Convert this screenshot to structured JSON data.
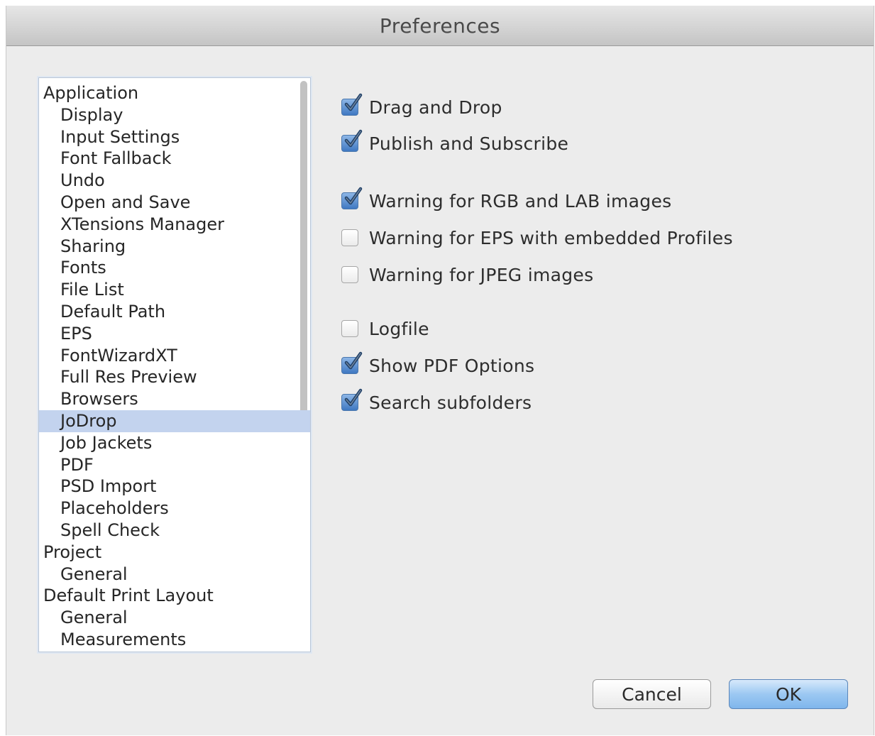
{
  "window": {
    "title": "Preferences"
  },
  "sidebar": {
    "selected": "JoDrop",
    "items": [
      {
        "label": "Application",
        "level": 0
      },
      {
        "label": "Display",
        "level": 1
      },
      {
        "label": "Input Settings",
        "level": 1
      },
      {
        "label": "Font Fallback",
        "level": 1
      },
      {
        "label": "Undo",
        "level": 1
      },
      {
        "label": "Open and Save",
        "level": 1
      },
      {
        "label": "XTensions Manager",
        "level": 1
      },
      {
        "label": "Sharing",
        "level": 1
      },
      {
        "label": "Fonts",
        "level": 1
      },
      {
        "label": "File List",
        "level": 1
      },
      {
        "label": "Default Path",
        "level": 1
      },
      {
        "label": "EPS",
        "level": 1
      },
      {
        "label": "FontWizardXT",
        "level": 1
      },
      {
        "label": "Full Res Preview",
        "level": 1
      },
      {
        "label": "Browsers",
        "level": 1
      },
      {
        "label": "JoDrop",
        "level": 1,
        "selected": true
      },
      {
        "label": "Job Jackets",
        "level": 1
      },
      {
        "label": "PDF",
        "level": 1
      },
      {
        "label": "PSD Import",
        "level": 1
      },
      {
        "label": "Placeholders",
        "level": 1
      },
      {
        "label": "Spell Check",
        "level": 1
      },
      {
        "label": "Project",
        "level": 0
      },
      {
        "label": "General",
        "level": 1
      },
      {
        "label": "Default Print Layout",
        "level": 0
      },
      {
        "label": "General",
        "level": 1
      },
      {
        "label": "Measurements",
        "level": 1
      }
    ]
  },
  "options": [
    {
      "label": "Drag and Drop",
      "checked": true
    },
    {
      "label": "Publish and Subscribe",
      "checked": true
    },
    {
      "label": "Warning for RGB and LAB images",
      "checked": true
    },
    {
      "label": "Warning for EPS with embedded Profiles",
      "checked": false
    },
    {
      "label": "Warning for JPEG images",
      "checked": false
    },
    {
      "label": "Logfile",
      "checked": false
    },
    {
      "label": "Show PDF Options",
      "checked": true
    },
    {
      "label": "Search subfolders",
      "checked": true
    }
  ],
  "buttons": {
    "cancel": "Cancel",
    "ok": "OK"
  },
  "colors": {
    "selection": "#c3d3ee",
    "checkbox_checked": "#3f78c2",
    "default_button": "#9cc8f2"
  }
}
